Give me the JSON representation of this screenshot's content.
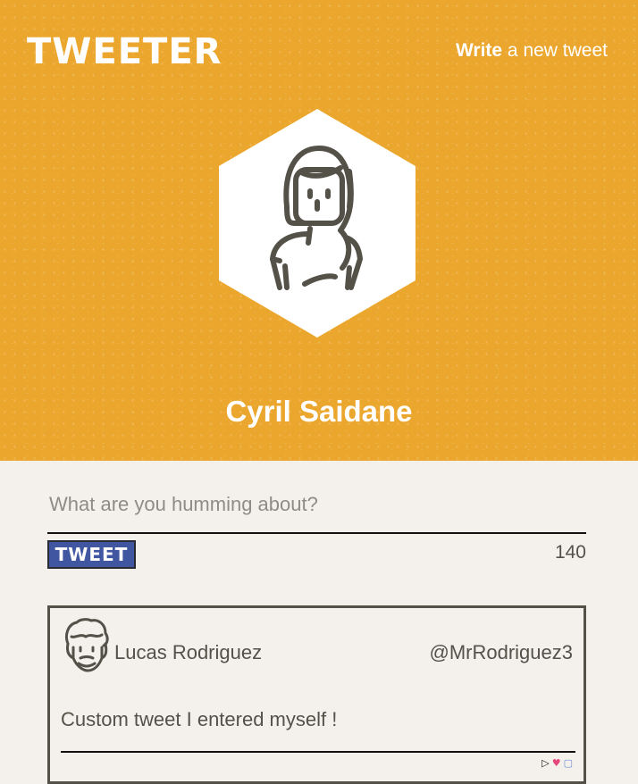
{
  "app": {
    "logo": "TWEETER",
    "nav": {
      "write_bold": "Write",
      "write_rest": " a new tweet"
    }
  },
  "profile": {
    "name": "Cyril Saidane",
    "avatar_icon": "woman-avatar-icon"
  },
  "compose": {
    "placeholder": "What are you humming about?",
    "value": "",
    "button_label": "TWEET",
    "counter": "140"
  },
  "tweets": [
    {
      "author": "Lucas Rodriguez",
      "handle": "@MrRodriguez3",
      "text": "Custom tweet I entered myself !",
      "avatar_icon": "man-avatar-icon",
      "actions": [
        "flag-icon",
        "heart-icon",
        "retweet-icon"
      ]
    }
  ],
  "colors": {
    "header_bg": "#eba62d",
    "page_bg": "#f4f1ec",
    "button_bg": "#4056a1",
    "text": "#545149",
    "heart": "#e5457a"
  }
}
